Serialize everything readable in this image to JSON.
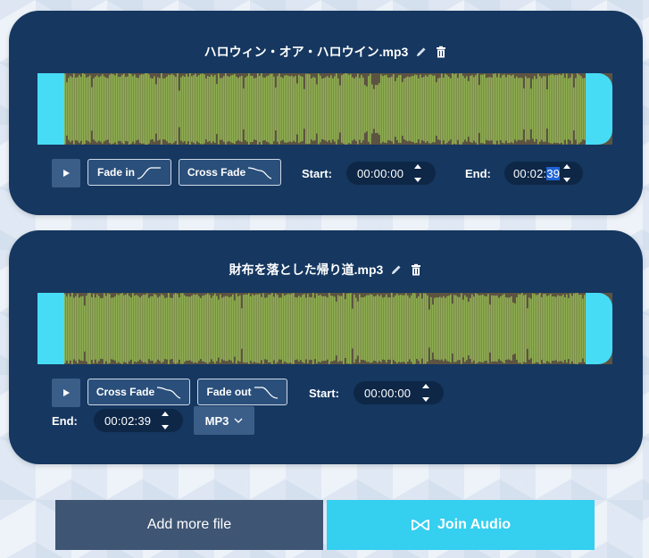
{
  "colors": {
    "card_bg": "#153760",
    "wave_fg": "#8fb150",
    "wave_bg": "#5d5342",
    "handle": "#46dcf5",
    "join_button": "#35cff0",
    "add_button": "#3e5574"
  },
  "tracks": [
    {
      "file_name": "ハロウィン・オア・ハロウイン.mp3",
      "fade_in_label": "Fade in",
      "cross_fade_label": "Cross Fade",
      "start_label": "Start:",
      "start_time": "00:00:00",
      "end_label": "End:",
      "end_time_prefix": "00:02:",
      "end_time_selected": "39"
    },
    {
      "file_name": "財布を落とした帰り道.mp3",
      "cross_fade_label": "Cross Fade",
      "fade_out_label": "Fade out",
      "start_label": "Start:",
      "start_time": "00:00:00",
      "end_label": "End:",
      "end_time": "00:02:39",
      "format": "MP3"
    }
  ],
  "actions": {
    "add_more_label": "Add more file",
    "join_label": "Join Audio"
  }
}
